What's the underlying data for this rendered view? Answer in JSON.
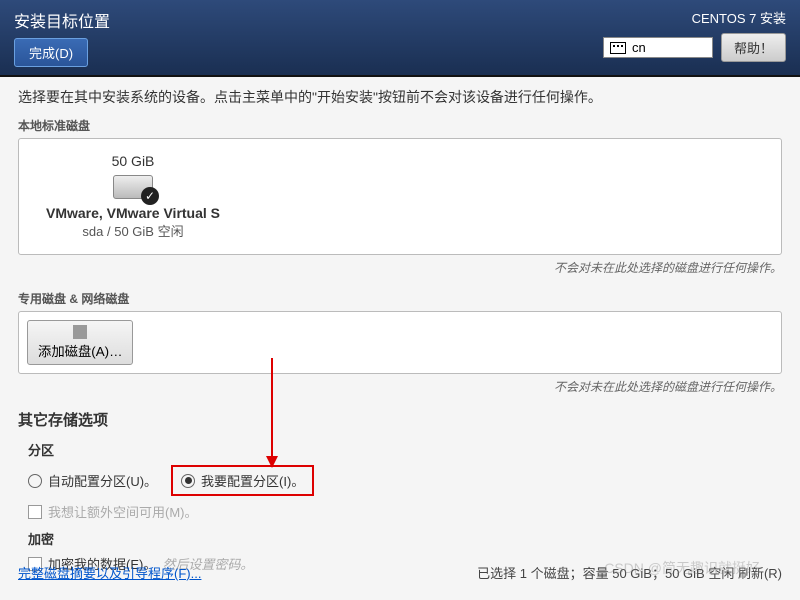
{
  "header": {
    "title": "安装目标位置",
    "done_btn": "完成(D)",
    "install_title": "CENTOS 7 安装",
    "lang": "cn",
    "help_btn": "帮助！"
  },
  "instr": "选择要在其中安装系统的设备。点击主菜单中的\"开始安装\"按钮前不会对该设备进行任何操作。",
  "local_disks_label": "本地标准磁盘",
  "disk": {
    "size": "50 GiB",
    "name": "VMware, VMware Virtual S",
    "info": "sda   /   50 GiB 空闲"
  },
  "note": "不会对未在此处选择的磁盘进行任何操作。",
  "special_label": "专用磁盘 & 网络磁盘",
  "add_disk_btn": "添加磁盘(A)…",
  "storage_title": "其它存储选项",
  "partition": {
    "label": "分区",
    "auto": "自动配置分区(U)。",
    "manual": "我要配置分区(I)。",
    "extra_space": "我想让额外空间可用(M)。"
  },
  "encrypt": {
    "label": "加密",
    "encrypt_data": "加密我的数据(E)。",
    "hint": "然后设置密码。"
  },
  "footer": {
    "link": "完整磁盘摘要以及引导程序(F)...",
    "status": "已选择 1 个磁盘；容量 50 GiB；50 GiB 空闲 刷新(R)"
  },
  "watermark": "CSDN @简无趣识就挺好"
}
